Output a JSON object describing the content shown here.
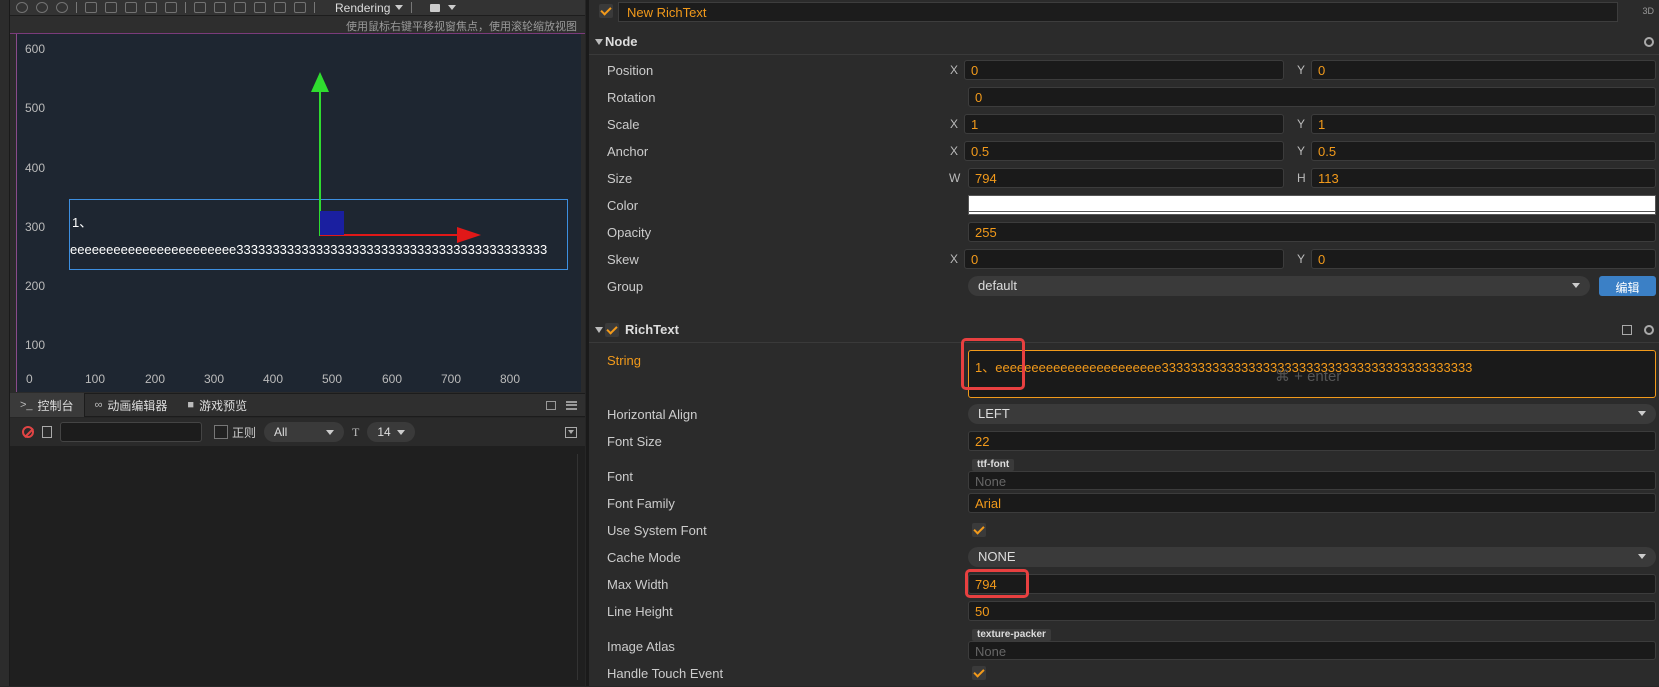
{
  "scene": {
    "render_mode": "Rendering",
    "hint": "使用鼠标右键平移视窗焦点，使用滚轮缩放视图",
    "y_ticks": [
      "600",
      "500",
      "400",
      "300",
      "200",
      "100"
    ],
    "x_ticks": [
      "0",
      "100",
      "200",
      "300",
      "400",
      "500",
      "600",
      "700",
      "800"
    ],
    "richtext_line1": "1、",
    "richtext_line2": "eeeeeeeeeeeeeeeeeeeeeee3333333333333333333333333333333333333333333"
  },
  "console": {
    "tabs": [
      {
        "icon": ">_",
        "label": "控制台"
      },
      {
        "icon": "∞",
        "label": "动画编辑器"
      },
      {
        "icon": "■",
        "label": "游戏预览"
      }
    ],
    "regex_label": "正则",
    "level": "All",
    "font_icon": "T",
    "font_size": "14"
  },
  "inspector": {
    "node_name": "New RichText",
    "badge_3d": "3D",
    "node_section": "Node",
    "position": {
      "label": "Position",
      "x": "0",
      "y": "0"
    },
    "rotation": {
      "label": "Rotation",
      "value": "0"
    },
    "scale": {
      "label": "Scale",
      "x": "1",
      "y": "1"
    },
    "anchor": {
      "label": "Anchor",
      "x": "0.5",
      "y": "0.5"
    },
    "size": {
      "label": "Size",
      "w": "794",
      "h": "113"
    },
    "color": {
      "label": "Color",
      "value": "#ffffff"
    },
    "opacity": {
      "label": "Opacity",
      "value": "255"
    },
    "skew": {
      "label": "Skew",
      "x": "0",
      "y": "0"
    },
    "group": {
      "label": "Group",
      "value": "default",
      "edit_button": "编辑"
    },
    "axis": {
      "x": "X",
      "y": "Y",
      "w": "W",
      "h": "H"
    },
    "richtext_section": "RichText",
    "string": {
      "label": "String",
      "value": "1、eeeeeeeeeeeeeeeeeeeeeee3333333333333333333333333333333333333333333",
      "hint": "⌘ + enter"
    },
    "horizontal_align": {
      "label": "Horizontal Align",
      "value": "LEFT"
    },
    "font_size": {
      "label": "Font Size",
      "value": "22"
    },
    "font": {
      "label": "Font",
      "tag": "ttf-font",
      "value": "None"
    },
    "font_family": {
      "label": "Font Family",
      "value": "Arial"
    },
    "use_system_font": {
      "label": "Use System Font"
    },
    "cache_mode": {
      "label": "Cache Mode",
      "value": "NONE"
    },
    "max_width": {
      "label": "Max Width",
      "value": "794"
    },
    "line_height": {
      "label": "Line Height",
      "value": "50"
    },
    "image_atlas": {
      "label": "Image Atlas",
      "tag": "texture-packer",
      "value": "None"
    },
    "handle_touch": {
      "label": "Handle Touch Event"
    }
  },
  "colors": {
    "accent": "#f29a1b",
    "highlight_box": "#e84040",
    "axis_x": "#e01818",
    "axis_y": "#2fdc2f",
    "edit_button": "#3b80c6"
  }
}
